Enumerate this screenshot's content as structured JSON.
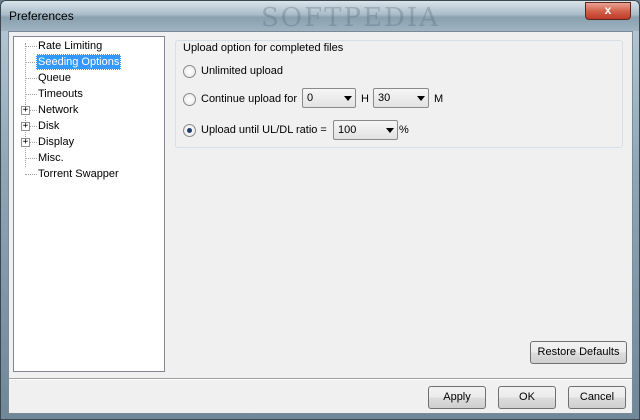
{
  "window": {
    "title": "Preferences",
    "watermark": "SOFTPEDIA",
    "close_label": "x"
  },
  "tree": {
    "items": [
      {
        "label": "Rate Limiting",
        "expandable": false
      },
      {
        "label": "Seeding Options",
        "expandable": false,
        "selected": true
      },
      {
        "label": "Queue",
        "expandable": false
      },
      {
        "label": "Timeouts",
        "expandable": false
      },
      {
        "label": "Network",
        "expandable": true
      },
      {
        "label": "Disk",
        "expandable": true
      },
      {
        "label": "Display",
        "expandable": true
      },
      {
        "label": "Misc.",
        "expandable": false
      },
      {
        "label": "Torrent Swapper",
        "expandable": false
      }
    ],
    "expander_symbol": "+"
  },
  "seeding": {
    "group_title": "Upload option for completed files",
    "option_unlimited": "Unlimited upload",
    "option_continue": "Continue upload for",
    "hours_value": "0",
    "hours_unit": "H",
    "minutes_value": "30",
    "minutes_unit": "M",
    "option_ratio": "Upload until UL/DL ratio =",
    "ratio_value": "100",
    "ratio_unit": "%",
    "selected_option": "ratio"
  },
  "buttons": {
    "restore_defaults": "Restore Defaults",
    "apply": "Apply",
    "ok": "OK",
    "cancel": "Cancel"
  }
}
